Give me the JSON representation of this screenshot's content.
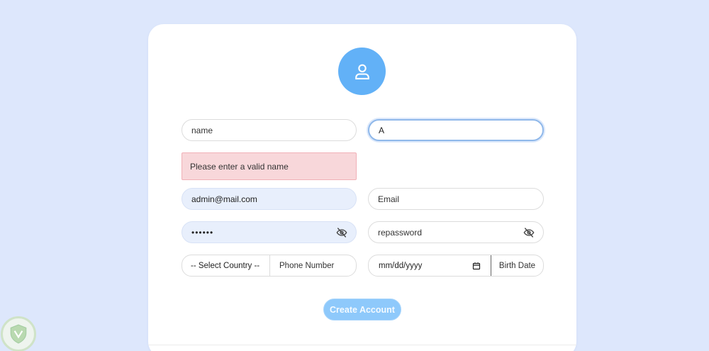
{
  "form": {
    "name_placeholder": "name",
    "name_value": "A",
    "error_message": "Please enter a valid name",
    "email_value": "admin@mail.com",
    "email_placeholder": "Email",
    "password_value": "••••••",
    "repassword_placeholder": "repassword",
    "country_select": "-- Select Country --",
    "phone_placeholder": "Phone Number",
    "date_value": "mm/dd/yyyy",
    "birth_date_label": "Birth Date",
    "submit_label": "Create Account"
  },
  "colors": {
    "page_background": "#dde7fc",
    "avatar": "#62b1f7",
    "error_background": "#f8d7da",
    "autofill_background": "#e8effc",
    "submit_button": "#8ec9fb"
  },
  "icons": {
    "avatar": "user-icon",
    "password_toggle": "eye-slash-icon",
    "calendar": "calendar-icon",
    "logo": "shield-logo"
  }
}
